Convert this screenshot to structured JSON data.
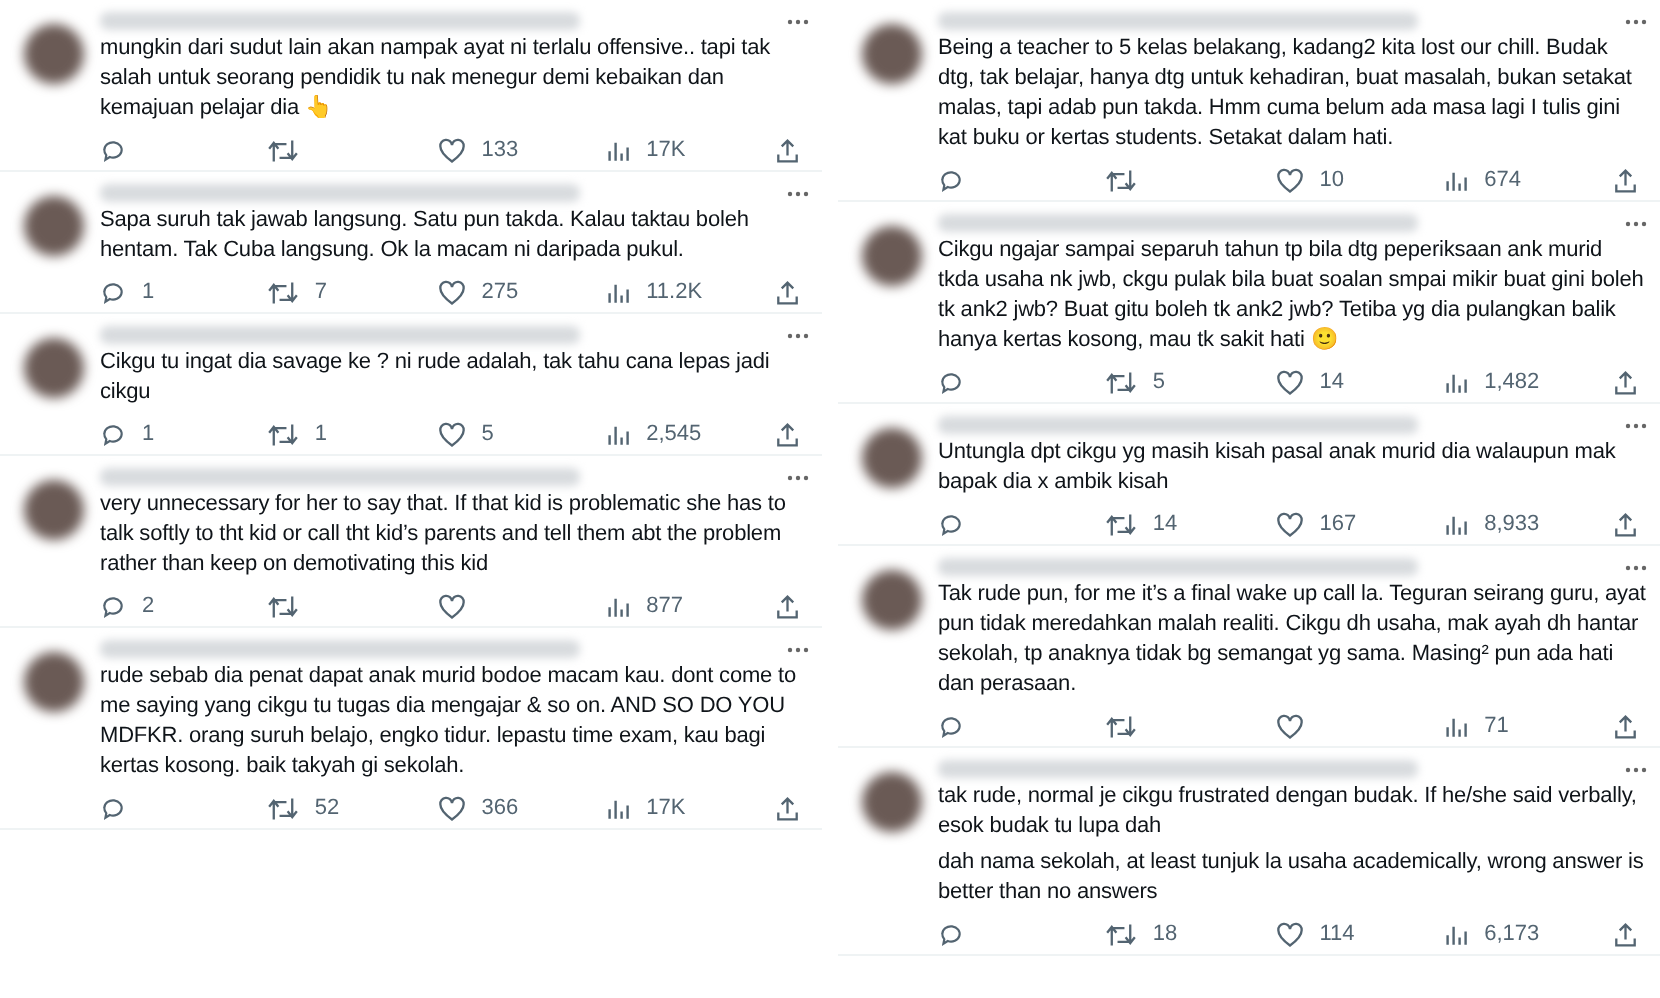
{
  "columns": [
    {
      "tweets": [
        {
          "paragraphs": [
            "mungkin dari sudut lain akan nampak ayat ni terlalu offensive.. tapi tak salah untuk seorang pendidik tu nak menegur demi kebaikan dan kemajuan pelajar dia 👆"
          ],
          "likes": "133",
          "views": "17K"
        },
        {
          "paragraphs": [
            "Sapa suruh tak jawab langsung. Satu pun takda. Kalau taktau boleh hentam. Tak Cuba langsung. Ok la macam ni daripada pukul."
          ],
          "replies": "1",
          "retweets": "7",
          "likes": "275",
          "views": "11.2K"
        },
        {
          "paragraphs": [
            "Cikgu tu ingat dia savage ke ? ni rude adalah, tak tahu cana lepas jadi cikgu"
          ],
          "replies": "1",
          "retweets": "1",
          "likes": "5",
          "views": "2,545"
        },
        {
          "paragraphs": [
            "very unnecessary for her to say that. If that kid is problematic she has to talk softly to tht kid or call tht kid’s parents and tell them abt the problem rather than keep on demotivating this kid"
          ],
          "replies": "2",
          "views": "877"
        },
        {
          "paragraphs": [
            "rude sebab dia penat dapat anak murid bodoe macam kau. dont come to me saying yang cikgu tu tugas dia mengajar & so on. AND SO DO YOU MDFKR. orang suruh belajo, engko tidur. lepastu time exam, kau bagi kertas kosong. baik takyah gi sekolah."
          ],
          "retweets": "52",
          "likes": "366",
          "views": "17K"
        }
      ]
    },
    {
      "tweets": [
        {
          "paragraphs": [
            "Being a teacher to 5 kelas belakang, kadang2 kita lost our chill. Budak dtg, tak belajar, hanya dtg untuk kehadiran, buat masalah, bukan setakat malas, tapi adab pun takda. Hmm cuma belum ada masa lagi I tulis gini kat buku or kertas students. Setakat dalam hati."
          ],
          "likes": "10",
          "views": "674"
        },
        {
          "paragraphs": [
            "Cikgu ngajar sampai separuh tahun tp bila dtg peperiksaan ank murid tkda usaha nk jwb, ckgu pulak bila buat soalan smpai mikir buat gini boleh tk ank2 jwb? Buat gitu boleh tk ank2 jwb? Tetiba yg dia pulangkan balik hanya kertas kosong, mau tk sakit hati 🙂"
          ],
          "retweets": "5",
          "likes": "14",
          "views": "1,482"
        },
        {
          "paragraphs": [
            "Untungla dpt cikgu yg masih kisah pasal anak murid dia walaupun mak bapak dia x ambik kisah"
          ],
          "retweets": "14",
          "likes": "167",
          "views": "8,933"
        },
        {
          "paragraphs": [
            "Tak rude pun, for me it’s a final wake up call la. Teguran seirang guru, ayat pun tidak meredahkan malah realiti. Cikgu dh usaha, mak ayah dh hantar sekolah, tp anaknya tidak bg semangat yg sama. Masing² pun ada hati dan perasaan."
          ],
          "views": "71"
        },
        {
          "paragraphs": [
            "tak rude, normal je cikgu frustrated dengan budak. If he/she said verbally, esok budak tu lupa dah",
            "dah nama sekolah, at least tunjuk la usaha academically, wrong answer is better than no answers"
          ],
          "retweets": "18",
          "likes": "114",
          "views": "6,173"
        }
      ]
    }
  ]
}
